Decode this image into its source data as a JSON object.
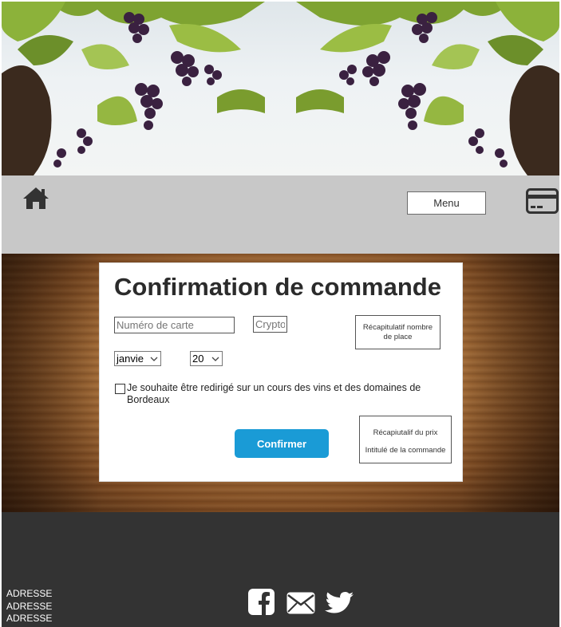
{
  "header": {
    "banner_alt": "vineyard-grapes-image"
  },
  "navbar": {
    "home_icon": "home-icon",
    "menu_label": "Menu",
    "card_icon": "credit-card-icon"
  },
  "form": {
    "title": "Confirmation de commande",
    "card_number_placeholder": "Numéro de carte",
    "crypto_placeholder": "Crypto",
    "recap_places": "Récapitulatif nombre de place",
    "month_selected": "janvie",
    "year_selected": "20",
    "checkbox_label": "Je souhaite être redirigé sur un cours des vins et des domaines de Bordeaux",
    "confirm_label": "Confirmer",
    "recap_price": "Récapiutalif du prix",
    "recap_order": "Intitulé de la commande",
    "accent_color": "#1a9bd6"
  },
  "footer": {
    "address_lines": [
      "ADRESSE",
      "ADRESSE",
      "ADRESSE"
    ],
    "social_icons": [
      "facebook-icon",
      "mail-icon",
      "twitter-icon"
    ],
    "background_color": "#333333"
  }
}
